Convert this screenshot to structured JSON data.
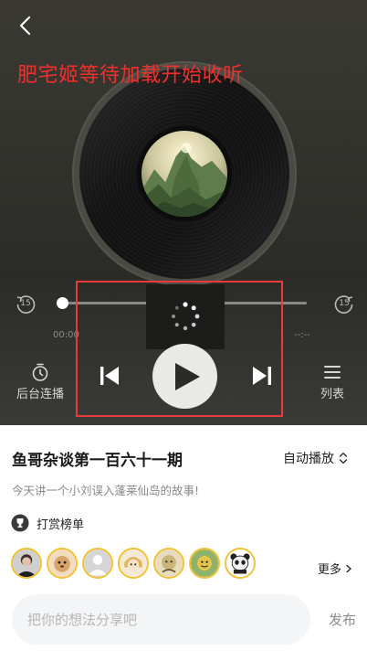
{
  "player": {
    "promo_text": "肥宅姬等待加载开始收听",
    "skip_back_label": "15",
    "skip_forward_label": "15",
    "current_time": "00:00",
    "total_time": "--:--",
    "background_play_label": "后台连播",
    "playlist_label": "列表",
    "progress": 0,
    "colors": {
      "promo": "#f0302c",
      "highlight": "#ea3b3b"
    }
  },
  "episode": {
    "title": "鱼哥杂谈第一百六十一期",
    "autoplay_label": "自动播放",
    "description": "今天讲一个小刘误入蓬莱仙岛的故事!",
    "reward_label": "打赏榜单",
    "more_label": "更多",
    "avatar_border_color": "#f3c133"
  },
  "comment": {
    "placeholder": "把你的想法分享吧",
    "publish_label": "发布"
  },
  "icons": [
    "back-icon",
    "skip-back-15-icon",
    "skip-forward-15-icon",
    "timer-icon",
    "list-icon",
    "previous-icon",
    "play-icon",
    "next-icon",
    "loading-spinner-icon",
    "trophy-icon",
    "chevron-up-down-icon",
    "chevron-right-icon"
  ]
}
